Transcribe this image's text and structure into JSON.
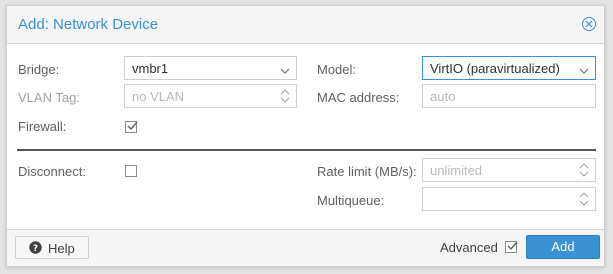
{
  "dialog": {
    "title": "Add: Network Device"
  },
  "left": {
    "bridge": {
      "label": "Bridge:",
      "value": "vmbr1"
    },
    "vlan_tag": {
      "label": "VLAN Tag:",
      "placeholder": "no VLAN"
    },
    "firewall": {
      "label": "Firewall:",
      "checked": true
    }
  },
  "right": {
    "model": {
      "label": "Model:",
      "value": "VirtIO (paravirtualized)"
    },
    "mac_address": {
      "label": "MAC address:",
      "placeholder": "auto"
    }
  },
  "advanced": {
    "disconnect": {
      "label": "Disconnect:",
      "checked": false
    },
    "rate_limit": {
      "label": "Rate limit (MB/s):",
      "placeholder": "unlimited"
    },
    "multiqueue": {
      "label": "Multiqueue:",
      "value": ""
    }
  },
  "footer": {
    "help_label": "Help",
    "advanced_label": "Advanced",
    "advanced_checked": true,
    "add_label": "Add"
  },
  "colors": {
    "accent": "#3892d4",
    "header_bg": "#f5f5f5",
    "border": "#cfcfcf"
  },
  "icons": {
    "close": "close-circle-icon",
    "dropdown": "chevron-down-icon",
    "spinner": "spinner-arrows-icon",
    "help": "question-circle-icon",
    "check": "checkmark-icon"
  }
}
